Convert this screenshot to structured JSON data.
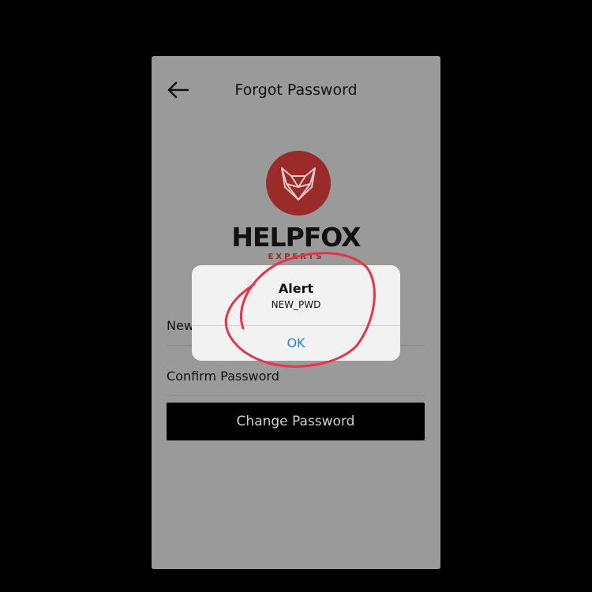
{
  "header": {
    "title": "Forgot Password",
    "back_icon": "arrow-left-icon"
  },
  "logo": {
    "icon": "fox-head-icon",
    "brand_name": "HELPFOX",
    "brand_sub": "EXPERTS",
    "circle_color": "#9b2a2b"
  },
  "form": {
    "new_password_label": "New",
    "confirm_password_label": "Confirm Password",
    "submit_label": "Change Password"
  },
  "alert": {
    "title": "Alert",
    "message": "NEW_PWD",
    "ok_label": "OK",
    "ok_color": "#2a7de1"
  },
  "annotation": {
    "color": "#e8334a"
  }
}
